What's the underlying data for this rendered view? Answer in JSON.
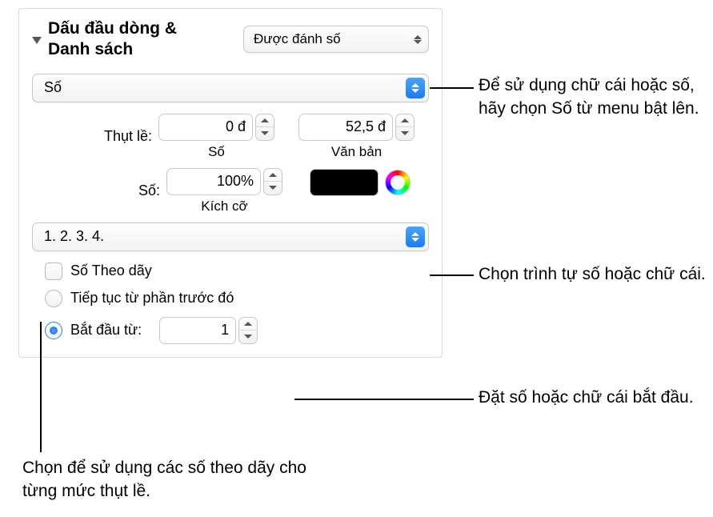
{
  "header": {
    "title": "Dấu đầu dòng & Danh sách"
  },
  "popups": {
    "style": "Được đánh số",
    "bulletType": "Số",
    "sequence": "1. 2. 3. 4."
  },
  "indent": {
    "label": "Thụt lề:",
    "numberValue": "0 đ",
    "numberCaption": "Số",
    "textValue": "52,5 đ",
    "textCaption": "Văn bản"
  },
  "size": {
    "label": "Số:",
    "value": "100%",
    "caption": "Kích cỡ"
  },
  "tiered": {
    "label": "Số Theo dãy"
  },
  "continue": {
    "label": "Tiếp tục từ phần trước đó"
  },
  "startFrom": {
    "label": "Bắt đầu từ:",
    "value": "1"
  },
  "callouts": {
    "bulletType": "Để sử dụng chữ cái hoặc số, hãy chọn Số từ menu bật lên.",
    "sequence": "Chọn trình tự số hoặc chữ cái.",
    "startFrom": "Đặt số hoặc chữ cái bắt đầu.",
    "tiered": "Chọn để sử dụng các số theo dãy cho từng mức thụt lề."
  }
}
